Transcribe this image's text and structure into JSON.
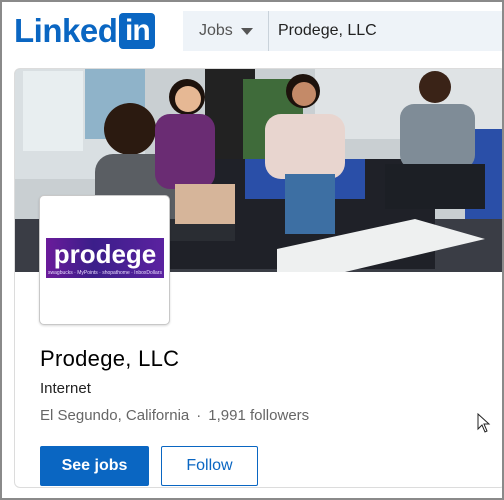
{
  "header": {
    "logo_word": "Linked",
    "logo_box": "in",
    "jobs_dropdown": "Jobs",
    "search_value": "Prodege, LLC"
  },
  "company": {
    "logo_word": "prodege",
    "logo_brands": "swagbucks · MyPoints · shopathome · InboxDollars",
    "name": "Prodege, LLC",
    "industry": "Internet",
    "location": "El Segundo, California",
    "separator": "·",
    "followers": "1,991 followers"
  },
  "actions": {
    "primary_label": "See jobs",
    "secondary_label": "Follow"
  },
  "colors": {
    "brand_blue": "#0a66c2",
    "logo_purple": "#4b1d92"
  },
  "icons": {
    "cursor": "mouse-pointer-icon",
    "caret": "chevron-down-icon"
  }
}
